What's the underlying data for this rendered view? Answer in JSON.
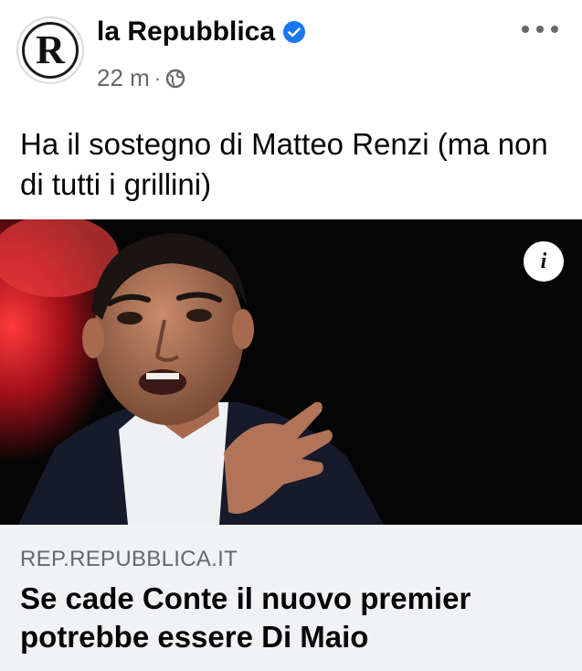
{
  "post": {
    "page_name": "la Repubblica",
    "time": "22 m",
    "separator": "·",
    "avatar_letter": "R",
    "text": "Ha il sostegno di Matteo Renzi (ma non di tutti i grillini)"
  },
  "media": {
    "info_label": "i"
  },
  "link": {
    "domain": "REP.REPUBBLICA.IT",
    "title": "Se cade Conte il nuovo premier potrebbe essere Di Maio"
  },
  "icons": {
    "verified": "verified-badge-icon",
    "audience": "globe-icon",
    "more": "more-options-icon",
    "info": "info-icon"
  },
  "colors": {
    "verified_blue": "#1877f2",
    "secondary_text": "#65676b",
    "preview_bg": "#f0f2f5"
  }
}
